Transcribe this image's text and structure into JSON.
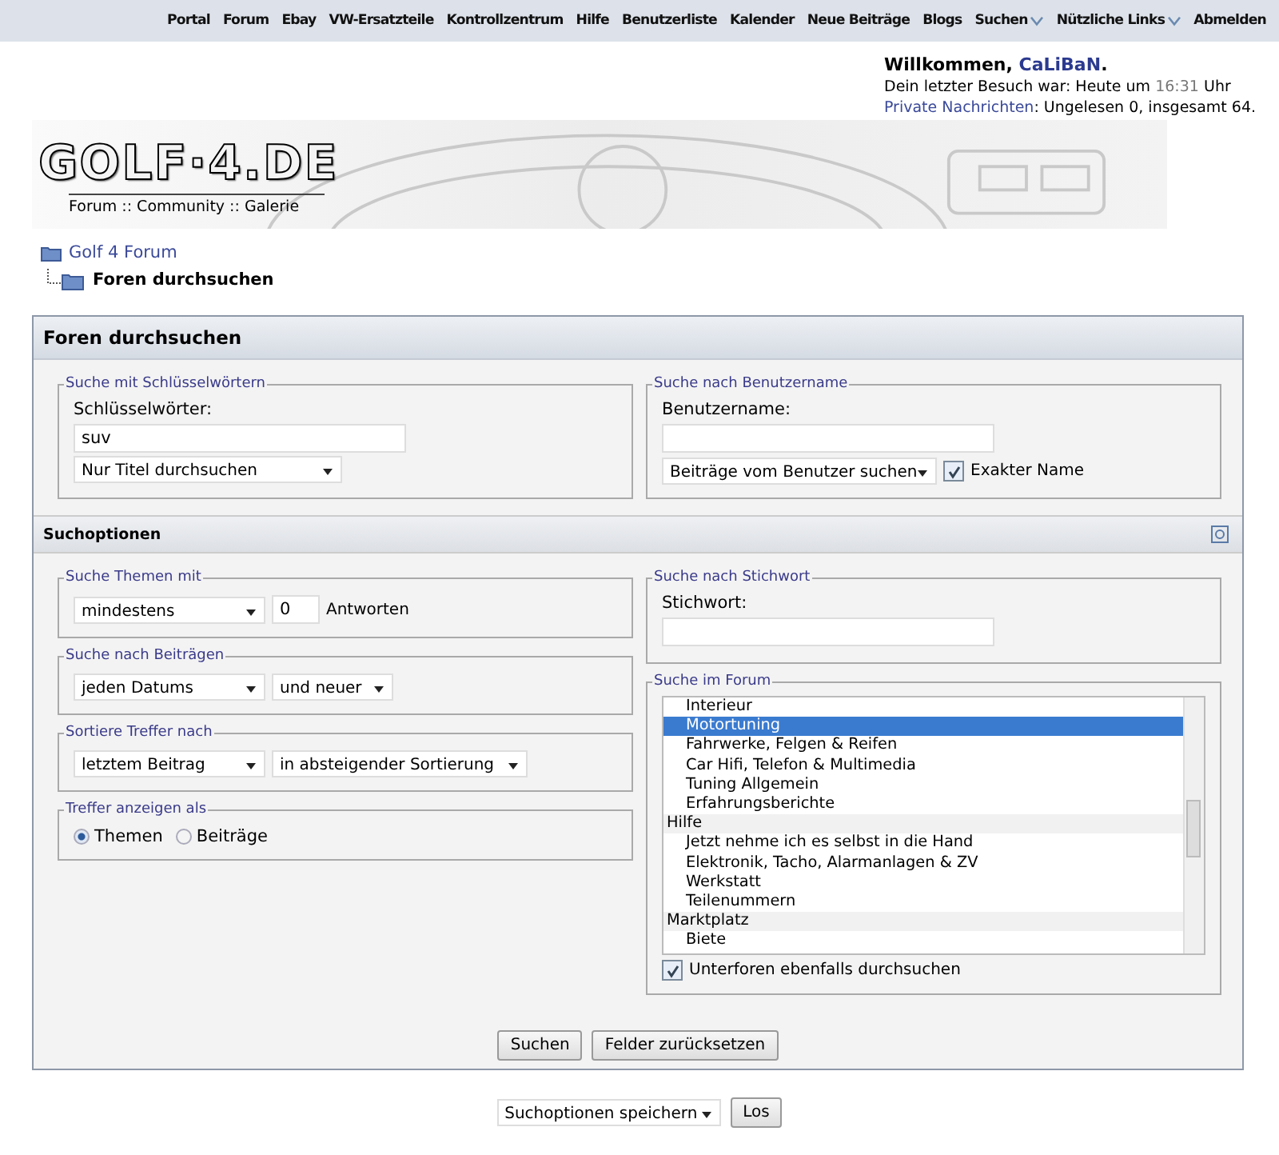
{
  "nav": [
    {
      "label": "Portal",
      "dropdown": false
    },
    {
      "label": "Forum",
      "dropdown": false
    },
    {
      "label": "Ebay",
      "dropdown": false
    },
    {
      "label": "VW-Ersatzteile",
      "dropdown": false
    },
    {
      "label": "Kontrollzentrum",
      "dropdown": false
    },
    {
      "label": "Hilfe",
      "dropdown": false
    },
    {
      "label": "Benutzerliste",
      "dropdown": false
    },
    {
      "label": "Kalender",
      "dropdown": false
    },
    {
      "label": "Neue Beiträge",
      "dropdown": false
    },
    {
      "label": "Blogs",
      "dropdown": false
    },
    {
      "label": "Suchen",
      "dropdown": true
    },
    {
      "label": "Nützliche Links",
      "dropdown": true
    },
    {
      "label": "Abmelden",
      "dropdown": false
    }
  ],
  "header": {
    "logo": "GOLF·4.DE",
    "tagline": "Forum :: Community :: Galerie",
    "welcome": "Willkommen,",
    "username": "CaLiBaN",
    "welcome_end": ".",
    "last_visit_label": "Dein letzter Besuch war: Heute um",
    "last_visit_time": "16:31",
    "last_visit_suffix": "Uhr",
    "pm_link": "Private Nachrichten",
    "pm_text": ": Ungelesen 0, insgesamt 64."
  },
  "breadcrumb": {
    "parent": "Golf 4 Forum",
    "current": "Foren durchsuchen"
  },
  "panel": {
    "title": "Foren durchsuchen",
    "keywords": {
      "legend": "Suche mit Schlüsselwörtern",
      "label": "Schlüsselwörter:",
      "value": "suv",
      "scope": "Nur Titel durchsuchen"
    },
    "user": {
      "legend": "Suche nach Benutzername",
      "label": "Benutzername:",
      "mode": "Beiträge vom Benutzer suchen",
      "exact_label": "Exakter Name",
      "exact_checked": true
    },
    "options_title": "Suchoptionen",
    "replies": {
      "legend": "Suche Themen mit",
      "mode": "mindestens",
      "count": "0",
      "suffix": "Antworten"
    },
    "date": {
      "legend": "Suche nach Beiträgen",
      "range": "jeden Datums",
      "direction": "und neuer"
    },
    "sort": {
      "legend": "Sortiere Treffer nach",
      "field": "letztem Beitrag",
      "order": "in absteigender Sortierung"
    },
    "display": {
      "legend": "Treffer anzeigen als",
      "options": [
        {
          "label": "Themen",
          "selected": true
        },
        {
          "label": "Beiträge",
          "selected": false
        }
      ]
    },
    "tag": {
      "legend": "Suche nach Stichwort",
      "label": "Stichwort:"
    },
    "forums": {
      "legend": "Suche im Forum",
      "groups": [
        {
          "children": [
            {
              "label": "Interieur",
              "selected": false
            },
            {
              "label": "Motortuning",
              "selected": true
            },
            {
              "label": "Fahrwerke, Felgen & Reifen",
              "selected": false
            },
            {
              "label": "Car Hifi, Telefon & Multimedia",
              "selected": false
            },
            {
              "label": "Tuning Allgemein",
              "selected": false
            },
            {
              "label": "Erfahrungsberichte",
              "selected": false
            }
          ]
        },
        {
          "label": "Hilfe",
          "selected": false,
          "children": [
            {
              "label": "Jetzt nehme ich es selbst in die Hand",
              "selected": false
            },
            {
              "label": "Elektronik, Tacho, Alarmanlagen & ZV",
              "selected": false
            },
            {
              "label": "Werkstatt",
              "selected": false
            },
            {
              "label": "Teilenummern",
              "selected": false
            }
          ]
        },
        {
          "label": "Marktplatz",
          "selected": false,
          "children": [
            {
              "label": "Biete",
              "selected": false
            }
          ]
        }
      ],
      "subforums_label": "Unterforen ebenfalls durchsuchen",
      "subforums_checked": true
    },
    "buttons": [
      "Suchen",
      "Felder zurücksetzen"
    ]
  },
  "save": {
    "select": "Suchoptionen speichern",
    "button": "Los"
  }
}
